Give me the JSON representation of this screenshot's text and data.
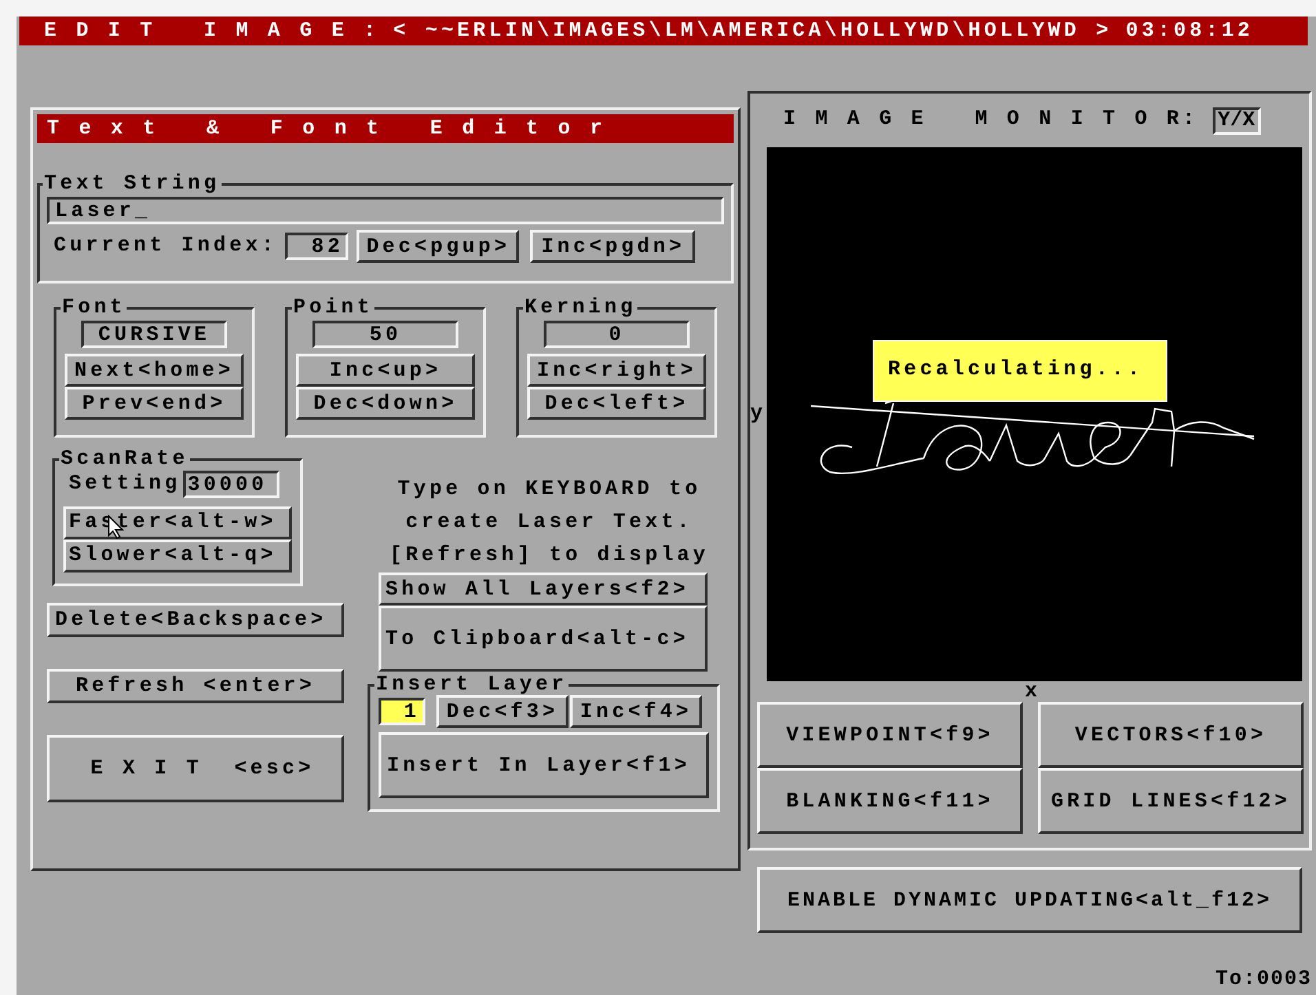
{
  "title_bar": {
    "title": "E D I T   I M A G E :",
    "path": "< ~~ERLIN\\IMAGES\\LM\\AMERICA\\HOLLYWD\\HOLLYWD >",
    "time": "03:08:12"
  },
  "editor": {
    "title": "T e x t   &   F o n t   E d i t o r",
    "text_string": {
      "legend": "Text String",
      "value": "Laser_",
      "index_label": "Current Index:",
      "index_value": "82",
      "buttons": [
        "Dec<pgup>",
        "Inc<pgdn>"
      ]
    },
    "groups": [
      {
        "legend": "Font",
        "value": "CURSIVE",
        "buttons": [
          "Next<home>",
          "Prev<end>"
        ]
      },
      {
        "legend": "Point",
        "value": "50",
        "buttons": [
          "Inc<up>",
          "Dec<down>"
        ]
      },
      {
        "legend": "Kerning",
        "value": "0",
        "buttons": [
          "Inc<right>",
          "Dec<left>"
        ]
      }
    ],
    "scan_rate": {
      "legend": "ScanRate",
      "label": "Setting",
      "value": "30000",
      "buttons": [
        "Faster<alt-w>",
        "Slower<alt-q>"
      ]
    },
    "actions": [
      "Delete<Backspace>",
      "Refresh <enter>"
    ],
    "exit": "E X I T  <esc>",
    "instructions": [
      "Type on KEYBOARD to",
      "create Laser Text.",
      "[Refresh] to display"
    ],
    "layer_buttons": [
      "Show All Layers<f2>",
      "To Clipboard<alt-c>"
    ],
    "insert_layer": {
      "legend": "Insert Layer",
      "value": "1",
      "buttons": [
        "Dec<f3>",
        "Inc<f4>"
      ],
      "insert": "Insert In Layer<f1>"
    }
  },
  "monitor": {
    "title": "I M A G E   M O N I T O R:",
    "mode": "Y/X",
    "y_axis": "y",
    "x_axis": "x",
    "popup": "Recalculating...",
    "buttons": [
      "VIEWPOINT<f9>",
      "VECTORS<f10>",
      "BLANKING<f11>",
      "GRID LINES<f12>"
    ]
  },
  "dynamic_button": "ENABLE DYNAMIC UPDATING<alt_f12>",
  "status": "To:0003"
}
